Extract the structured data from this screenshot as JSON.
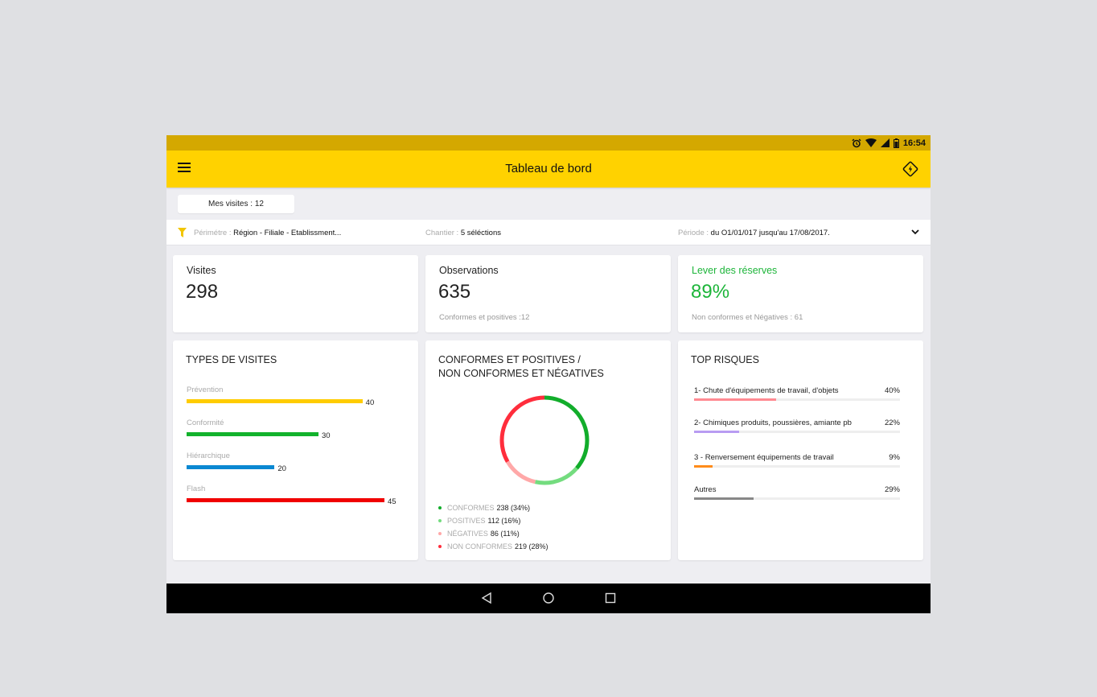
{
  "status_bar": {
    "time": "16:54",
    "icons": [
      "alarm-icon",
      "wifi-icon",
      "signal-icon",
      "battery-icon"
    ]
  },
  "app_bar": {
    "title": "Tableau de bord",
    "menu_icon": "hamburger-menu-icon",
    "action_icon": "warning-diamond-lightning-icon"
  },
  "visits_pill": {
    "label": "Mes visites : 12"
  },
  "filters": {
    "perimetre_label": "Périmétre : ",
    "perimetre_value": "Région - Filiale - Etablissment...",
    "chantier_label": "Chantier : ",
    "chantier_value": "5 séléctions",
    "periode_label": "Période : ",
    "periode_value": "du O1/01/017 jusqu'au 17/08/2017."
  },
  "kpis": {
    "visites": {
      "title": "Visites",
      "value": "298"
    },
    "observations": {
      "title": "Observations",
      "value": "635",
      "sub": "Conformes et positives :12"
    },
    "reserves": {
      "title": "Lever des réserves",
      "value": "89%",
      "sub": "Non conformes et Négatives : 61",
      "color": "#1db53a"
    }
  },
  "types_visites": {
    "title": "TYPES DE VISITES",
    "max": 45,
    "items": [
      {
        "label": "Prévention",
        "value": 40,
        "color": "#ffcc00"
      },
      {
        "label": "Conformité",
        "value": 30,
        "color": "#12b22c"
      },
      {
        "label": "Hiérarchique",
        "value": 20,
        "color": "#0a88d2"
      },
      {
        "label": "Flash",
        "value": 45,
        "color": "#f00000"
      }
    ]
  },
  "conformes": {
    "title_line1": "CONFORMES ET POSITIVES /",
    "title_line2": "NON CONFORMES ET NÉGATIVES",
    "segments": [
      {
        "label": "CONFORMES",
        "value": "238 (34%)",
        "count": 238,
        "color": "#12ad2b"
      },
      {
        "label": "POSITIVES",
        "value": "112 (16%)",
        "count": 112,
        "color": "#74dc7f"
      },
      {
        "label": "NÉGATIVES",
        "value": "86 (11%)",
        "count": 86,
        "color": "#ffa8a8"
      },
      {
        "label": "NON CONFORMES",
        "value": "219 (28%)",
        "count": 219,
        "color": "#ff2d3c"
      }
    ]
  },
  "top_risques": {
    "title": "TOP RISQUES",
    "items": [
      {
        "label": "1- Chute  d'équipements de travail, d'objets",
        "value": "40%",
        "percent": 40,
        "color": "#ff8a92"
      },
      {
        "label": "2- Chimiques  produits, poussières, amiante pb",
        "value": "22%",
        "percent": 22,
        "color": "#b89cf2"
      },
      {
        "label": "3 - Renversement équipements de travail",
        "value": "9%",
        "percent": 9,
        "color": "#ff8c1a"
      },
      {
        "label": "Autres",
        "value": "29%",
        "percent": 29,
        "color": "#888888"
      }
    ]
  },
  "nav_bar": {
    "icons": [
      "back-icon",
      "home-icon",
      "recents-icon"
    ]
  }
}
